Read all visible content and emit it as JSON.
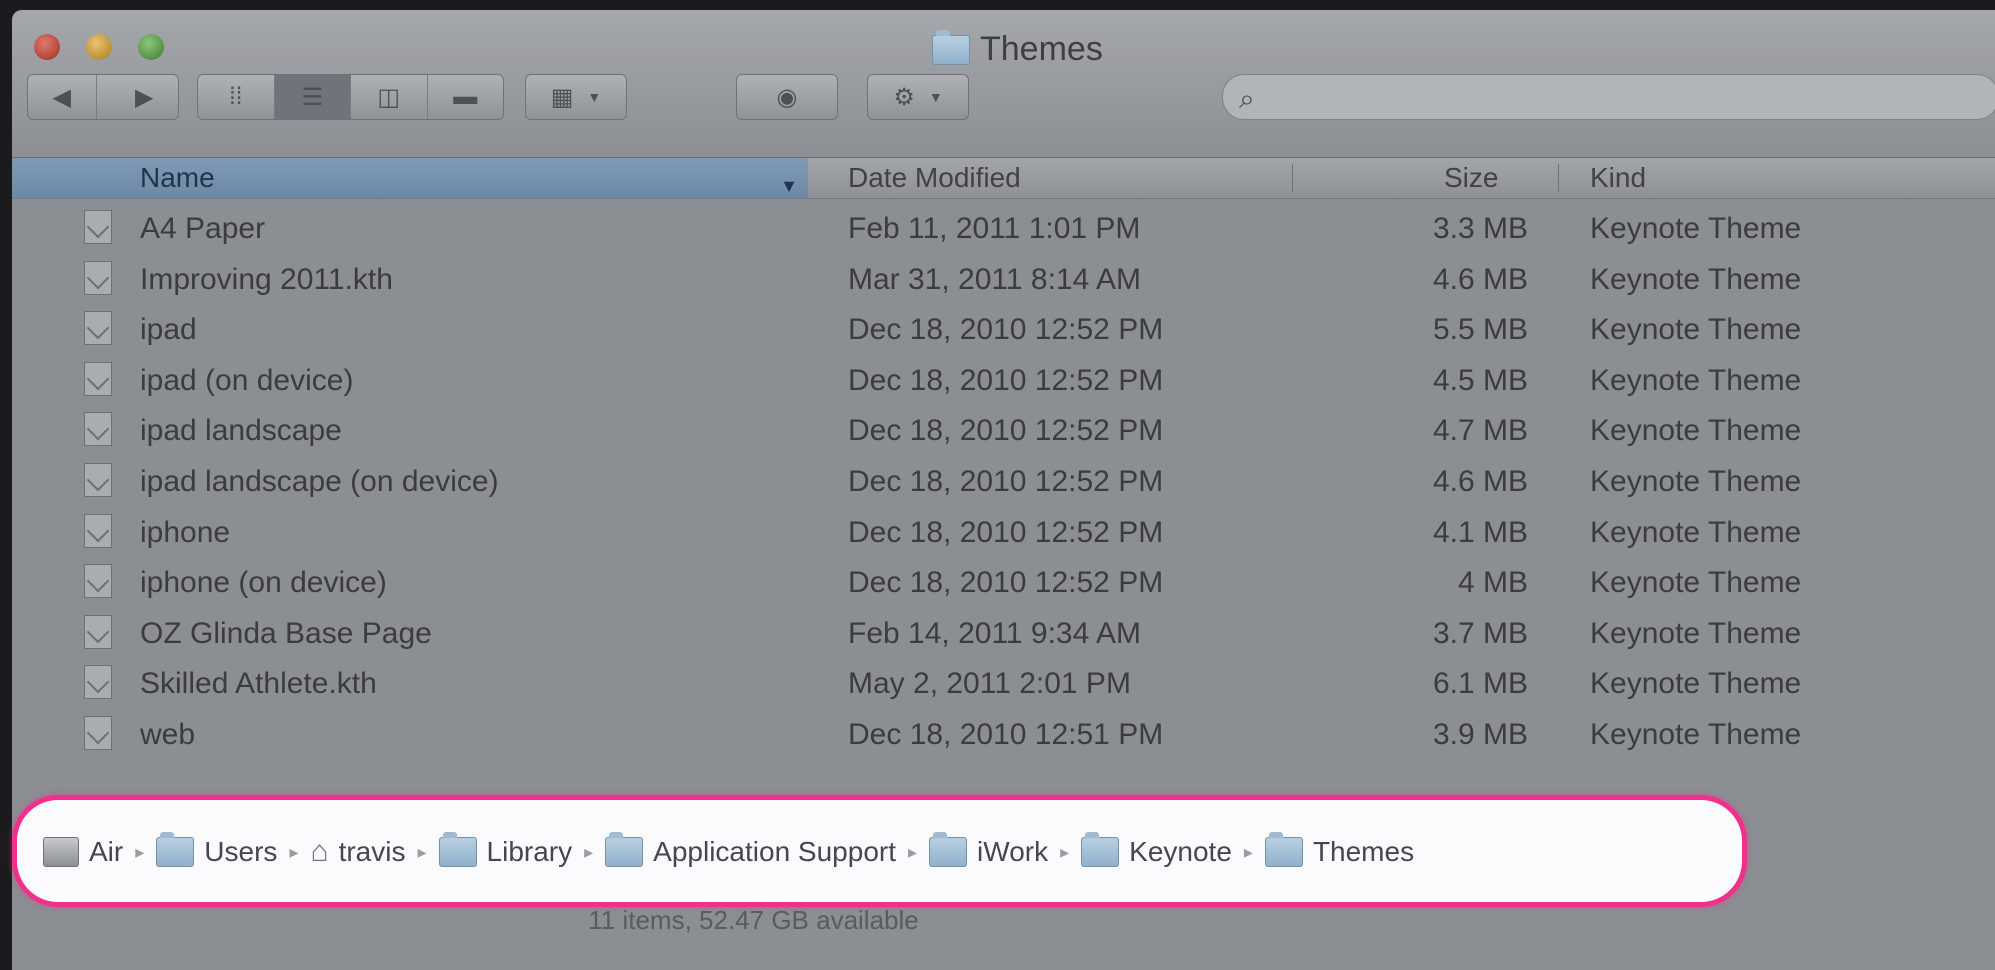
{
  "window": {
    "title": "Themes"
  },
  "toolbar": {
    "back_icon": "chevron-left-icon",
    "forward_icon": "chevron-right-icon",
    "view_modes": [
      "icon-view-icon",
      "list-view-icon",
      "column-view-icon",
      "cover-flow-icon"
    ],
    "arrange_icon": "grid-arrange-icon",
    "quicklook_icon": "eye-icon",
    "action_icon": "gear-icon",
    "search": {
      "placeholder": "",
      "value": ""
    }
  },
  "columns": {
    "name": "Name",
    "date": "Date Modified",
    "size": "Size",
    "kind": "Kind"
  },
  "files": [
    {
      "name": "A4 Paper",
      "date": "Feb 11, 2011 1:01 PM",
      "size": "3.3 MB",
      "kind": "Keynote Theme"
    },
    {
      "name": "Improving 2011.kth",
      "date": "Mar 31, 2011 8:14 AM",
      "size": "4.6 MB",
      "kind": "Keynote Theme"
    },
    {
      "name": "ipad",
      "date": "Dec 18, 2010 12:52 PM",
      "size": "5.5 MB",
      "kind": "Keynote Theme"
    },
    {
      "name": "ipad (on device)",
      "date": "Dec 18, 2010 12:52 PM",
      "size": "4.5 MB",
      "kind": "Keynote Theme"
    },
    {
      "name": "ipad landscape",
      "date": "Dec 18, 2010 12:52 PM",
      "size": "4.7 MB",
      "kind": "Keynote Theme"
    },
    {
      "name": "ipad landscape (on device)",
      "date": "Dec 18, 2010 12:52 PM",
      "size": "4.6 MB",
      "kind": "Keynote Theme"
    },
    {
      "name": "iphone",
      "date": "Dec 18, 2010 12:52 PM",
      "size": "4.1 MB",
      "kind": "Keynote Theme"
    },
    {
      "name": "iphone (on device)",
      "date": "Dec 18, 2010 12:52 PM",
      "size": "4 MB",
      "kind": "Keynote Theme"
    },
    {
      "name": "OZ Glinda Base Page",
      "date": "Feb 14, 2011 9:34 AM",
      "size": "3.7 MB",
      "kind": "Keynote Theme"
    },
    {
      "name": "Skilled Athlete.kth",
      "date": "May 2, 2011 2:01 PM",
      "size": "6.1 MB",
      "kind": "Keynote Theme"
    },
    {
      "name": "web",
      "date": "Dec 18, 2010 12:51 PM",
      "size": "3.9 MB",
      "kind": "Keynote Theme"
    }
  ],
  "pathbar": {
    "items": [
      {
        "label": "Air",
        "icon": "disk-icon"
      },
      {
        "label": "Users",
        "icon": "folder-icon"
      },
      {
        "label": "travis",
        "icon": "home-icon"
      },
      {
        "label": "Library",
        "icon": "folder-icon"
      },
      {
        "label": "Application Support",
        "icon": "folder-icon"
      },
      {
        "label": "iWork",
        "icon": "folder-icon"
      },
      {
        "label": "Keynote",
        "icon": "folder-icon"
      },
      {
        "label": "Themes",
        "icon": "folder-icon"
      }
    ],
    "highlight_color": "#f0308a"
  },
  "status": {
    "text": "11 items, 52.47 GB available"
  }
}
